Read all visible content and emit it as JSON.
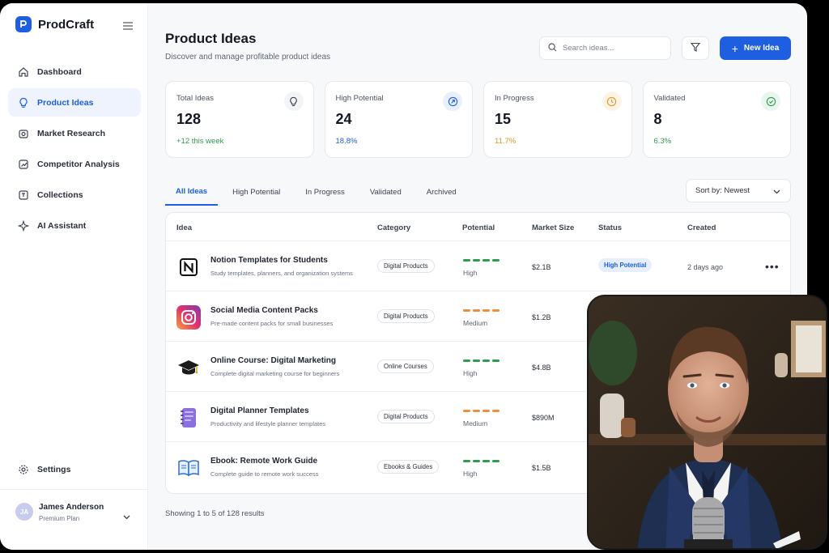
{
  "brand": {
    "name": "ProdCraft"
  },
  "sidebar": {
    "items": [
      {
        "label": "Dashboard",
        "icon": "home-icon"
      },
      {
        "label": "Product Ideas",
        "icon": "lightbulb-icon",
        "active": true
      },
      {
        "label": "Market Research",
        "icon": "research-icon"
      },
      {
        "label": "Competitor Analysis",
        "icon": "chart-icon"
      },
      {
        "label": "Collections",
        "icon": "collection-icon"
      },
      {
        "label": "AI Assistant",
        "icon": "sparkle-icon"
      }
    ],
    "settings_label": "Settings"
  },
  "user": {
    "initials": "JA",
    "name": "James Anderson",
    "plan": "Premium Plan"
  },
  "header": {
    "title": "Product Ideas",
    "subtitle": "Discover and manage profitable product ideas",
    "search_placeholder": "Search ideas...",
    "new_button": "New Idea"
  },
  "stats": [
    {
      "label": "Total Ideas",
      "value": "128",
      "sub": "+12 this week",
      "color": "#2e9b4e",
      "icon": "lightbulb-icon"
    },
    {
      "label": "High Potential",
      "value": "24",
      "sub": "18.8%",
      "color": "#1d5fe0",
      "icon": "arrow-up-right-icon"
    },
    {
      "label": "In Progress",
      "value": "15",
      "sub": "11.7%",
      "color": "#e8962a",
      "icon": "clock-icon"
    },
    {
      "label": "Validated",
      "value": "8",
      "sub": "6.3%",
      "color": "#2e9b4e",
      "icon": "check-circle-icon"
    }
  ],
  "tabs": [
    "All Ideas",
    "High Potential",
    "In Progress",
    "Validated",
    "Archived"
  ],
  "sort_label": "Sort by: Newest",
  "table": {
    "columns": [
      "Idea",
      "Category",
      "Potential",
      "Market Size",
      "Status",
      "Created"
    ],
    "rows": [
      {
        "name": "Notion Templates for Students",
        "desc": "Study templates, planners, and organization systems",
        "category": "Digital Products",
        "potential": "High",
        "market": "$2.1B",
        "status": "High Potential",
        "created": "2 days ago",
        "logo": "notion-icon"
      },
      {
        "name": "Social Media Content Packs",
        "desc": "Pre-made content packs for small businesses",
        "category": "Digital Products",
        "potential": "Medium",
        "market": "$1.2B",
        "logo": "instagram-icon"
      },
      {
        "name": "Online Course: Digital Marketing",
        "desc": "Complete digital marketing course for beginners",
        "category": "Online Courses",
        "potential": "High",
        "market": "$4.8B",
        "logo": "graduation-cap-icon"
      },
      {
        "name": "Digital Planner Templates",
        "desc": "Productivity and lifestyle planner templates",
        "category": "Digital Products",
        "potential": "Medium",
        "market": "$890M",
        "logo": "planner-icon"
      },
      {
        "name": "Ebook: Remote Work Guide",
        "desc": "Complete guide to remote work success",
        "category": "Ebooks & Guides",
        "potential": "High",
        "market": "$1.5B",
        "logo": "book-icon"
      }
    ]
  },
  "footer": {
    "showing": "Showing 1 to 5 of 128 results"
  },
  "colors": {
    "accent": "#1d5fe0",
    "high": "#2e9b4e",
    "medium": "#f08f3a"
  }
}
